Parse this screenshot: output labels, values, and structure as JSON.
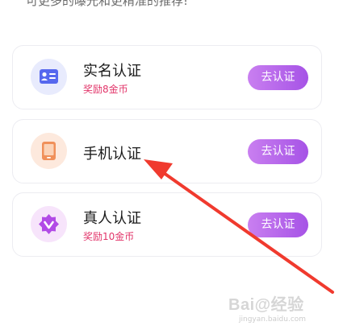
{
  "header": {
    "partial_text": "可更多的曝光和更精准的推荐!"
  },
  "cards": [
    {
      "title": "实名认证",
      "reward": "奖励8金币",
      "button": "去认证",
      "icon": "id-card-icon"
    },
    {
      "title": "手机认证",
      "reward": "",
      "button": "去认证",
      "icon": "phone-icon"
    },
    {
      "title": "真人认证",
      "reward": "奖励10金币",
      "button": "去认证",
      "icon": "verified-face-icon"
    }
  ],
  "annotation": {
    "arrow_color": "#f03a2e"
  },
  "watermark": {
    "brand": "Bai@经验",
    "url": "jingyan.baidu.com"
  },
  "colors": {
    "button_gradient": [
      "#c97ff0",
      "#a653e6"
    ],
    "reward_text": "#e2356a"
  }
}
